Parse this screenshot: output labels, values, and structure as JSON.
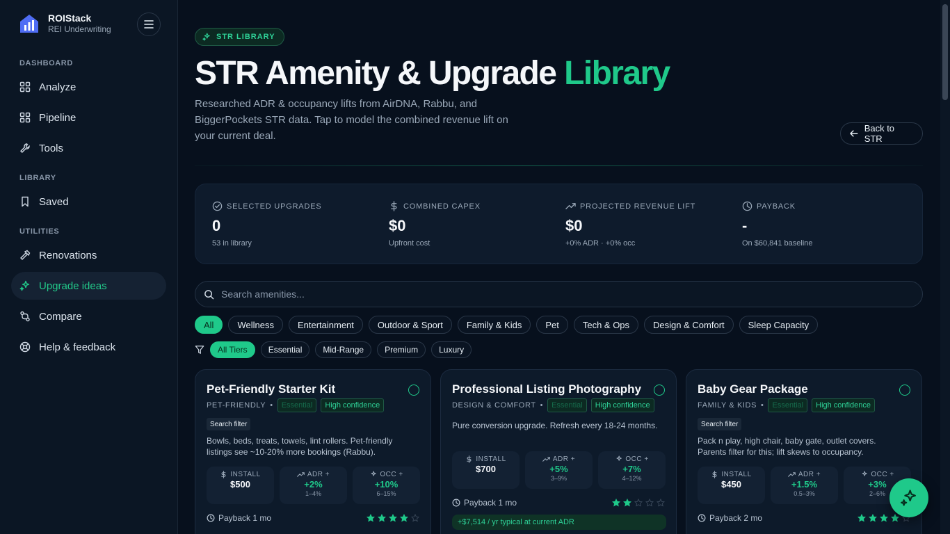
{
  "brand": {
    "name": "ROIStack",
    "sub": "REI Underwriting",
    "color": "#4f6df5"
  },
  "sidebar": {
    "sections": [
      "DASHBOARD",
      "LIBRARY",
      "UTILITIES"
    ],
    "items": [
      {
        "label": "Analyze",
        "icon": "grid-icon"
      },
      {
        "label": "Pipeline",
        "icon": "grid-icon"
      },
      {
        "label": "Tools",
        "icon": "wrench-icon"
      },
      {
        "label": "Saved",
        "icon": "bookmark-icon"
      },
      {
        "label": "Renovations",
        "icon": "hammer-icon"
      },
      {
        "label": "Upgrade ideas",
        "icon": "sparkles-icon",
        "active": true
      },
      {
        "label": "Compare",
        "icon": "compare-icon"
      },
      {
        "label": "Help & feedback",
        "icon": "help-icon"
      }
    ]
  },
  "header": {
    "tag": "STR LIBRARY",
    "title_main": "STR Amenity & Upgrade ",
    "title_accent": "Library",
    "subtitle": "Researched ADR & occupancy lifts from AirDNA, Rabbu, and BiggerPockets STR data. Tap to model the combined revenue lift on your current deal.",
    "back_label": "Back to STR"
  },
  "stats": [
    {
      "label": "SELECTED UPGRADES",
      "value": "0",
      "sub": "53 in library",
      "icon": "check-circle-icon"
    },
    {
      "label": "COMBINED CAPEX",
      "value": "$0",
      "sub": "Upfront cost",
      "icon": "dollar-icon"
    },
    {
      "label": "PROJECTED REVENUE LIFT",
      "value": "$0",
      "sub": "+0% ADR · +0% occ",
      "icon": "trending-up-icon"
    },
    {
      "label": "PAYBACK",
      "value": "-",
      "sub": "On $60,841 baseline",
      "icon": "clock-icon"
    }
  ],
  "search": {
    "placeholder": "Search amenities..."
  },
  "categories": [
    "All",
    "Wellness",
    "Entertainment",
    "Outdoor & Sport",
    "Family & Kids",
    "Pet",
    "Tech & Ops",
    "Design & Comfort",
    "Sleep Capacity"
  ],
  "tiers": [
    "All Tiers",
    "Essential",
    "Mid-Range",
    "Premium",
    "Luxury"
  ],
  "cards": [
    {
      "title": "Pet-Friendly Starter Kit",
      "category": "PET-FRIENDLY",
      "tier": "Essential",
      "confidence": "High confidence",
      "filter": "Search filter",
      "desc": "Bowls, beds, treats, towels, lint rollers. Pet-friendly listings see ~10-20% more bookings (Rabbu).",
      "install": "$500",
      "adr": "+2%",
      "adr_range": "1–4%",
      "occ": "+10%",
      "occ_range": "6–15%",
      "payback": "Payback 1 mo",
      "rating": 4,
      "lift": ""
    },
    {
      "title": "Professional Listing Photography",
      "category": "DESIGN & COMFORT",
      "tier": "Essential",
      "confidence": "High confidence",
      "filter": "",
      "desc": "Pure conversion upgrade. Refresh every 18-24 months.",
      "install": "$700",
      "adr": "+5%",
      "adr_range": "3–9%",
      "occ": "+7%",
      "occ_range": "4–12%",
      "payback": "Payback 1 mo",
      "rating": 2,
      "lift": "+$7,514 / yr typical at current ADR"
    },
    {
      "title": "Baby Gear Package",
      "category": "FAMILY & KIDS",
      "tier": "Essential",
      "confidence": "High confidence",
      "filter": "Search filter",
      "desc": "Pack n play, high chair, baby gate, outlet covers. Parents filter for this; lift skews to occupancy.",
      "install": "$450",
      "adr": "+1.5%",
      "adr_range": "0.5–3%",
      "occ": "+3%",
      "occ_range": "2–6%",
      "payback": "Payback 2 mo",
      "rating": 4,
      "lift": ""
    }
  ],
  "metric_labels": {
    "install": "INSTALL",
    "adr": "ADR +",
    "occ": "OCC +"
  },
  "accent_color": "#1fc98a"
}
